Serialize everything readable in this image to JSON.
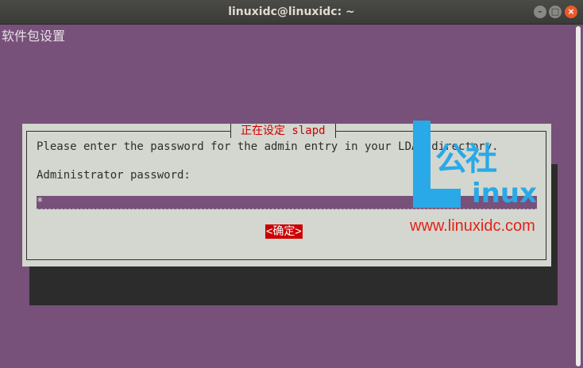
{
  "window": {
    "title": "linuxidc@linuxidc: ~",
    "controls": [
      "minimize",
      "maximize",
      "close"
    ]
  },
  "terminal": {
    "header_text": "软件包设置",
    "background_color": "#775179"
  },
  "dialog": {
    "title": "正在设定 slapd",
    "message": "Please enter the password for the admin entry in your LDAP directory.",
    "field_label": "Administrator password:",
    "password_value": "*",
    "ok_button": "<确定>"
  },
  "watermark": {
    "logo_cn": "公社",
    "logo_en": "inux",
    "url": "www.linuxidc.com"
  },
  "colors": {
    "accent_red": "#cc0000",
    "dialog_bg": "#d3d7cf",
    "watermark_blue": "#29a9e8"
  }
}
